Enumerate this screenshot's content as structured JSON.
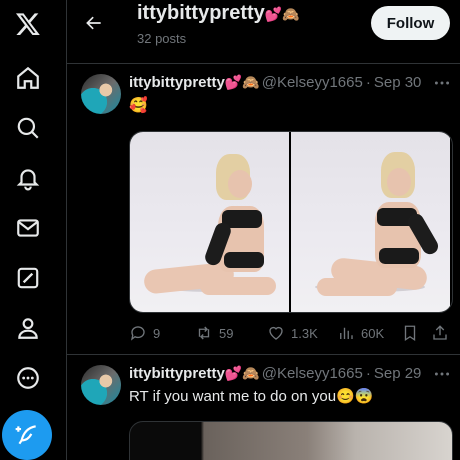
{
  "nav": {
    "items": [
      {
        "icon": "x-logo-icon"
      },
      {
        "icon": "home-icon"
      },
      {
        "icon": "search-icon"
      },
      {
        "icon": "notifications-icon"
      },
      {
        "icon": "messages-icon"
      },
      {
        "icon": "grok-icon"
      },
      {
        "icon": "profile-icon"
      },
      {
        "icon": "more-icon"
      }
    ],
    "post_button_icon": "compose-icon"
  },
  "header": {
    "name": "ittybittypretty",
    "name_emoji": "💕🙈",
    "post_count": "32 posts",
    "follow_label": "Follow"
  },
  "tweets": [
    {
      "name": "ittybittypretty",
      "name_emoji": "💕🙈",
      "handle": "@Kelseyy1665",
      "date": "Sep 30",
      "text": "🥰",
      "actions": {
        "replies": "9",
        "reposts": "59",
        "likes": "1.3K",
        "views": "60K"
      }
    },
    {
      "name": "ittybittypretty",
      "name_emoji": "💕🙈",
      "handle": "@Kelseyy1665",
      "date": "Sep 29",
      "text": "RT if you want me to do on you😊😨"
    }
  ],
  "colors": {
    "background": "#000000",
    "divider": "#2f3336",
    "accent": "#1d9bf0",
    "muted": "#71767b",
    "text": "#e7e9ea"
  }
}
